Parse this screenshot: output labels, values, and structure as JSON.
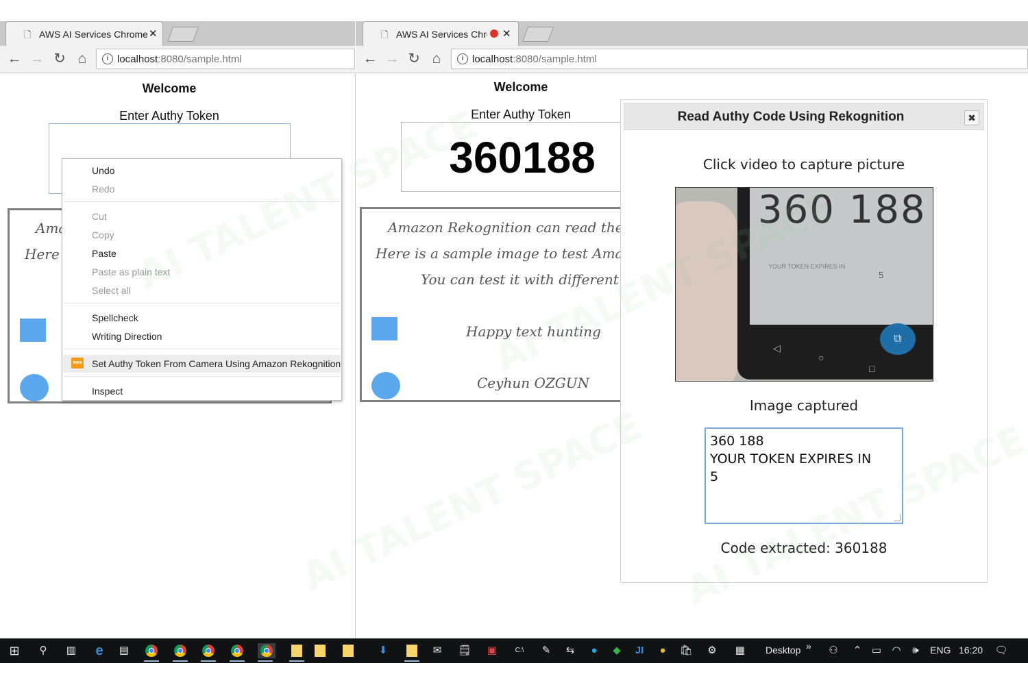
{
  "left_browser": {
    "tab": {
      "title": "AWS AI Services Chrome",
      "close": "✕"
    },
    "address": {
      "host": "localhost",
      "path": ":8080/sample.html"
    },
    "page": {
      "welcome": "Welcome",
      "prompt": "Enter Authy Token",
      "sample_lines": [
        "Ama",
        "Here i"
      ]
    },
    "context_menu": {
      "items": [
        {
          "label": "Undo",
          "enabled": true
        },
        {
          "label": "Redo",
          "enabled": false
        },
        {
          "label": "Cut",
          "enabled": false
        },
        {
          "label": "Copy",
          "enabled": false
        },
        {
          "label": "Paste",
          "enabled": true
        },
        {
          "label": "Paste as plain text",
          "enabled": false
        },
        {
          "label": "Select all",
          "enabled": false
        },
        {
          "label": "Spellcheck",
          "enabled": true
        },
        {
          "label": "Writing Direction",
          "enabled": true
        },
        {
          "label": "Set Authy Token From Camera Using Amazon Rekognition",
          "enabled": true,
          "highlighted": true
        },
        {
          "label": "Inspect",
          "enabled": true
        }
      ]
    }
  },
  "right_browser": {
    "tab": {
      "title": "AWS AI Services Chro",
      "close": "✕"
    },
    "address": {
      "host": "localhost",
      "path": ":8080/sample.html"
    },
    "page": {
      "welcome": "Welcome",
      "prompt": "Enter Authy Token",
      "token_value": "360188",
      "sample_lines": [
        "Amazon Rekognition can read the text in",
        "Here is a sample image to test Amazon Rek",
        "You can test it with different images",
        "Happy text hunting",
        "Ceyhun OZGUN"
      ]
    },
    "modal": {
      "title": "Read Authy Code Using Rekognition",
      "close": "✖",
      "instruction": "Click video to capture picture",
      "video_overlay": {
        "code": "360 188",
        "expires_label": "YOUR TOKEN EXPIRES IN",
        "seconds": "5"
      },
      "status": "Image captured",
      "ocr_text": "360 188\nYOUR TOKEN EXPIRES IN\n5",
      "code_extracted": "Code extracted: 360188"
    }
  },
  "taskbar": {
    "desktop_label": "Desktop",
    "chevron": "»",
    "language": "ENG",
    "time": "16:20"
  },
  "colors": {
    "shape_blue": "#5ba8ec",
    "input_border": "#7aa7dc",
    "taskbar": "#101214"
  }
}
